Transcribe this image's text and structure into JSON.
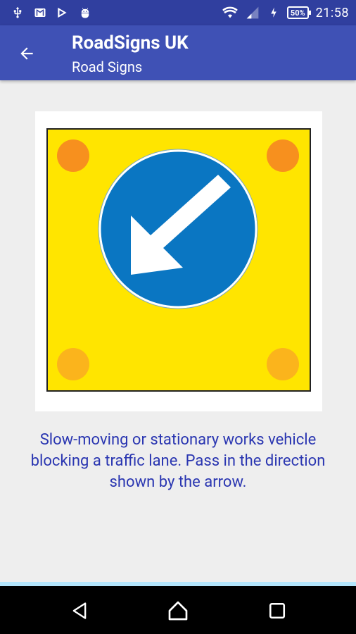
{
  "status_bar": {
    "left_icons": [
      "usb-icon",
      "gmail-icon",
      "play-store-icon",
      "android-debug-icon"
    ],
    "right_icons": [
      "wifi-icon",
      "signal-icon",
      "charging-icon",
      "battery-icon"
    ],
    "battery_percent": "50%",
    "time": "21:58"
  },
  "app_bar": {
    "back_icon": "arrow-back-icon",
    "title": "RoadSigns UK",
    "subtitle": "Road Signs"
  },
  "sign": {
    "icon": "keep-left-works-vehicle-sign",
    "colors": {
      "board": "#ffe500",
      "circle": "#0a76c2",
      "arrow": "#ffffff",
      "lamp": "#f7901e"
    }
  },
  "description": "Slow-moving or stationary works vehicle blocking a traffic lane. Pass in the direction shown by the arrow.",
  "nav_bar": {
    "buttons": [
      "nav-back-icon",
      "nav-home-icon",
      "nav-recents-icon"
    ]
  },
  "colors": {
    "status_bar": "#303f9f",
    "app_bar": "#3f51b5",
    "background": "#eeeeee",
    "description_text": "#2a36b1"
  }
}
